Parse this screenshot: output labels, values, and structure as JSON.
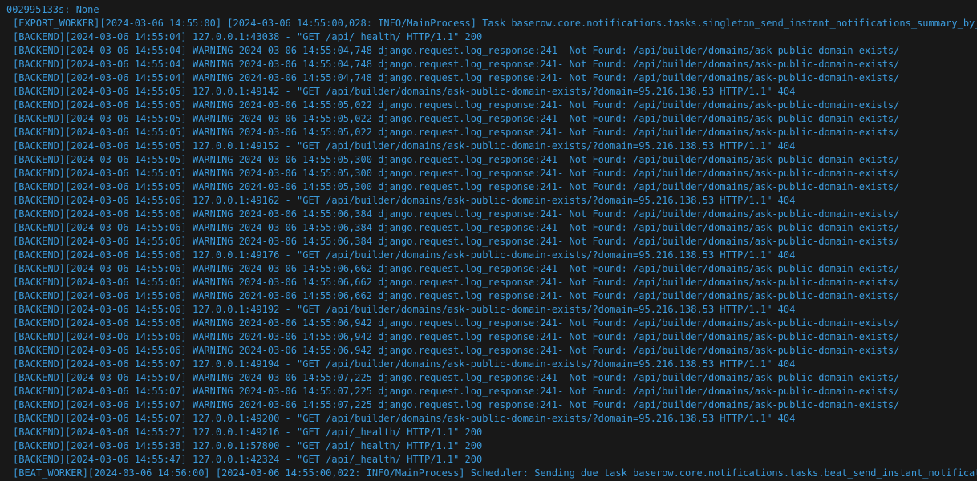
{
  "terminal": {
    "text_color": "#3b9bdc",
    "background": "#181818",
    "lines": [
      "002995133s: None",
      "[EXPORT_WORKER][2024-03-06 14:55:00] [2024-03-06 14:55:00,028: INFO/MainProcess] Task baserow.core.notifications.tasks.singleton_send_instant_notifications_summary_by_email",
      "[BACKEND][2024-03-06 14:55:04] 127.0.0.1:43038 - \"GET /api/_health/ HTTP/1.1\" 200",
      "[BACKEND][2024-03-06 14:55:04] WARNING 2024-03-06 14:55:04,748 django.request.log_response:241- Not Found: /api/builder/domains/ask-public-domain-exists/",
      "[BACKEND][2024-03-06 14:55:04] WARNING 2024-03-06 14:55:04,748 django.request.log_response:241- Not Found: /api/builder/domains/ask-public-domain-exists/",
      "[BACKEND][2024-03-06 14:55:04] WARNING 2024-03-06 14:55:04,748 django.request.log_response:241- Not Found: /api/builder/domains/ask-public-domain-exists/",
      "[BACKEND][2024-03-06 14:55:05] 127.0.0.1:49142 - \"GET /api/builder/domains/ask-public-domain-exists/?domain=95.216.138.53 HTTP/1.1\" 404",
      "[BACKEND][2024-03-06 14:55:05] WARNING 2024-03-06 14:55:05,022 django.request.log_response:241- Not Found: /api/builder/domains/ask-public-domain-exists/",
      "[BACKEND][2024-03-06 14:55:05] WARNING 2024-03-06 14:55:05,022 django.request.log_response:241- Not Found: /api/builder/domains/ask-public-domain-exists/",
      "[BACKEND][2024-03-06 14:55:05] WARNING 2024-03-06 14:55:05,022 django.request.log_response:241- Not Found: /api/builder/domains/ask-public-domain-exists/",
      "[BACKEND][2024-03-06 14:55:05] 127.0.0.1:49152 - \"GET /api/builder/domains/ask-public-domain-exists/?domain=95.216.138.53 HTTP/1.1\" 404",
      "[BACKEND][2024-03-06 14:55:05] WARNING 2024-03-06 14:55:05,300 django.request.log_response:241- Not Found: /api/builder/domains/ask-public-domain-exists/",
      "[BACKEND][2024-03-06 14:55:05] WARNING 2024-03-06 14:55:05,300 django.request.log_response:241- Not Found: /api/builder/domains/ask-public-domain-exists/",
      "[BACKEND][2024-03-06 14:55:05] WARNING 2024-03-06 14:55:05,300 django.request.log_response:241- Not Found: /api/builder/domains/ask-public-domain-exists/",
      "[BACKEND][2024-03-06 14:55:06] 127.0.0.1:49162 - \"GET /api/builder/domains/ask-public-domain-exists/?domain=95.216.138.53 HTTP/1.1\" 404",
      "[BACKEND][2024-03-06 14:55:06] WARNING 2024-03-06 14:55:06,384 django.request.log_response:241- Not Found: /api/builder/domains/ask-public-domain-exists/",
      "[BACKEND][2024-03-06 14:55:06] WARNING 2024-03-06 14:55:06,384 django.request.log_response:241- Not Found: /api/builder/domains/ask-public-domain-exists/",
      "[BACKEND][2024-03-06 14:55:06] WARNING 2024-03-06 14:55:06,384 django.request.log_response:241- Not Found: /api/builder/domains/ask-public-domain-exists/",
      "[BACKEND][2024-03-06 14:55:06] 127.0.0.1:49176 - \"GET /api/builder/domains/ask-public-domain-exists/?domain=95.216.138.53 HTTP/1.1\" 404",
      "[BACKEND][2024-03-06 14:55:06] WARNING 2024-03-06 14:55:06,662 django.request.log_response:241- Not Found: /api/builder/domains/ask-public-domain-exists/",
      "[BACKEND][2024-03-06 14:55:06] WARNING 2024-03-06 14:55:06,662 django.request.log_response:241- Not Found: /api/builder/domains/ask-public-domain-exists/",
      "[BACKEND][2024-03-06 14:55:06] WARNING 2024-03-06 14:55:06,662 django.request.log_response:241- Not Found: /api/builder/domains/ask-public-domain-exists/",
      "[BACKEND][2024-03-06 14:55:06] 127.0.0.1:49192 - \"GET /api/builder/domains/ask-public-domain-exists/?domain=95.216.138.53 HTTP/1.1\" 404",
      "[BACKEND][2024-03-06 14:55:06] WARNING 2024-03-06 14:55:06,942 django.request.log_response:241- Not Found: /api/builder/domains/ask-public-domain-exists/",
      "[BACKEND][2024-03-06 14:55:06] WARNING 2024-03-06 14:55:06,942 django.request.log_response:241- Not Found: /api/builder/domains/ask-public-domain-exists/",
      "[BACKEND][2024-03-06 14:55:06] WARNING 2024-03-06 14:55:06,942 django.request.log_response:241- Not Found: /api/builder/domains/ask-public-domain-exists/",
      "[BACKEND][2024-03-06 14:55:07] 127.0.0.1:49194 - \"GET /api/builder/domains/ask-public-domain-exists/?domain=95.216.138.53 HTTP/1.1\" 404",
      "[BACKEND][2024-03-06 14:55:07] WARNING 2024-03-06 14:55:07,225 django.request.log_response:241- Not Found: /api/builder/domains/ask-public-domain-exists/",
      "[BACKEND][2024-03-06 14:55:07] WARNING 2024-03-06 14:55:07,225 django.request.log_response:241- Not Found: /api/builder/domains/ask-public-domain-exists/",
      "[BACKEND][2024-03-06 14:55:07] WARNING 2024-03-06 14:55:07,225 django.request.log_response:241- Not Found: /api/builder/domains/ask-public-domain-exists/",
      "[BACKEND][2024-03-06 14:55:07] 127.0.0.1:49200 - \"GET /api/builder/domains/ask-public-domain-exists/?domain=95.216.138.53 HTTP/1.1\" 404",
      "[BACKEND][2024-03-06 14:55:27] 127.0.0.1:49216 - \"GET /api/_health/ HTTP/1.1\" 200",
      "[BACKEND][2024-03-06 14:55:38] 127.0.0.1:57800 - \"GET /api/_health/ HTTP/1.1\" 200",
      "[BACKEND][2024-03-06 14:55:47] 127.0.0.1:42324 - \"GET /api/_health/ HTTP/1.1\" 200",
      "[BEAT_WORKER][2024-03-06 14:56:00] [2024-03-06 14:55:00,022: INFO/MainProcess] Scheduler: Sending due task baserow.core.notifications.tasks.beat_send_instant_notifications_"
    ]
  }
}
